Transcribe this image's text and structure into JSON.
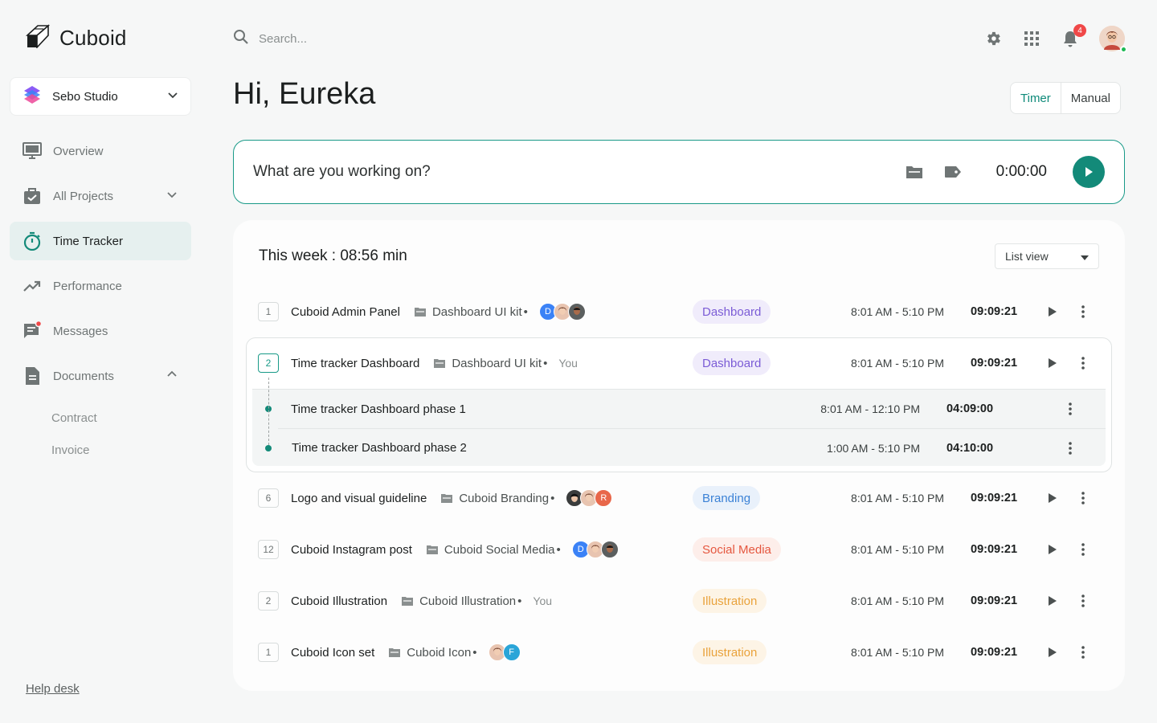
{
  "app": {
    "name": "Cuboid"
  },
  "workspace": {
    "name": "Sebo Studio"
  },
  "sidebar": {
    "items": [
      {
        "label": "Overview"
      },
      {
        "label": "All Projects"
      },
      {
        "label": "Time Tracker"
      },
      {
        "label": "Performance"
      },
      {
        "label": "Messages"
      },
      {
        "label": "Documents"
      }
    ],
    "documents_children": [
      "Contract",
      "Invoice"
    ],
    "help": "Help desk"
  },
  "header": {
    "search_placeholder": "Search...",
    "notification_count": "4"
  },
  "greeting": "Hi, Eureka",
  "mode": {
    "timer": "Timer",
    "manual": "Manual"
  },
  "timer": {
    "placeholder": "What are you working on?",
    "clock": "0:00:00"
  },
  "panel": {
    "title": "This week : 08:56 min",
    "view_select": "List view",
    "rows": [
      {
        "num": "1",
        "task": "Cuboid Admin Panel",
        "project": "Dashboard UI kit",
        "avatars": [
          "D",
          "",
          ""
        ],
        "tag": "Dashboard",
        "range": "8:01 AM - 5:10 PM",
        "duration": "09:09:21"
      },
      {
        "num": "2",
        "task": "Time tracker Dashboard",
        "project": "Dashboard UI kit",
        "assignee": "You",
        "tag": "Dashboard",
        "range": "8:01 AM - 5:10 PM",
        "duration": "09:09:21"
      },
      {
        "num": "6",
        "task": "Logo and visual guideline",
        "project": "Cuboid Branding",
        "avatars": [
          "",
          "",
          "R"
        ],
        "tag": "Branding",
        "range": "8:01 AM - 5:10 PM",
        "duration": "09:09:21"
      },
      {
        "num": "12",
        "task": "Cuboid Instagram post",
        "project": "Cuboid Social Media",
        "avatars": [
          "D",
          "",
          ""
        ],
        "tag": "Social Media",
        "range": "8:01 AM - 5:10 PM",
        "duration": "09:09:21"
      },
      {
        "num": "2",
        "task": "Cuboid Illustration",
        "project": "Cuboid Illustration",
        "assignee": "You",
        "tag": "Illustration",
        "range": "8:01 AM - 5:10 PM",
        "duration": "09:09:21"
      },
      {
        "num": "1",
        "task": "Cuboid Icon set",
        "project": "Cuboid Icon",
        "avatars": [
          "",
          "F"
        ],
        "tag": "Illustration",
        "range": "8:01 AM - 5:10 PM",
        "duration": "09:09:21"
      }
    ],
    "subtasks": [
      {
        "name": "Time tracker Dashboard phase 1",
        "range": "8:01 AM - 12:10 PM",
        "duration": "04:09:00"
      },
      {
        "name": "Time tracker Dashboard phase 2",
        "range": "1:00 AM - 5:10 PM",
        "duration": "04:10:00"
      }
    ]
  },
  "colors": {
    "accent": "#138a79",
    "tag_dashboard": "#7b5cd6",
    "tag_branding": "#3b82d6",
    "tag_social": "#e5573f",
    "tag_illustration": "#e9a23b"
  }
}
